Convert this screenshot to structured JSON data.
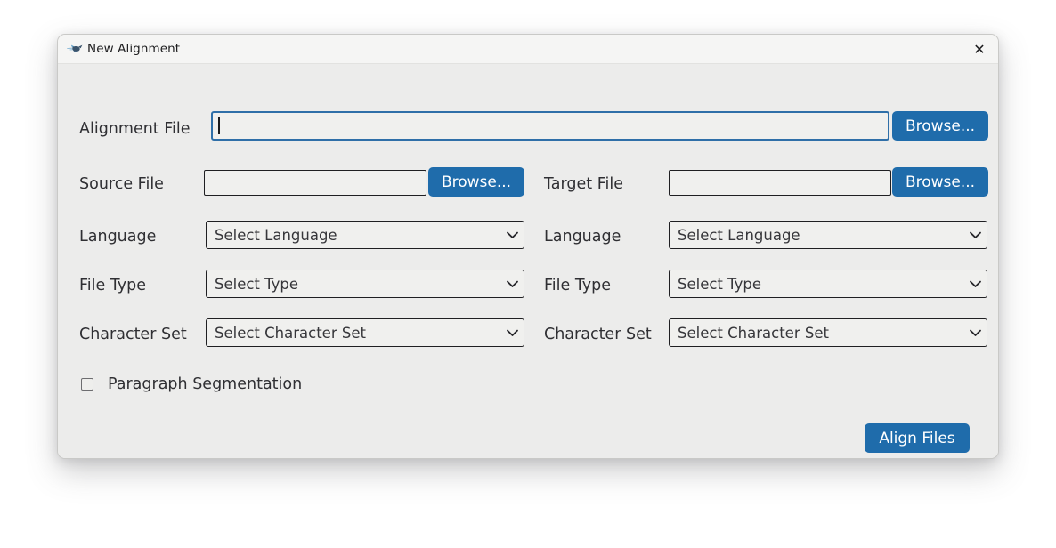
{
  "window": {
    "title": "New Alignment",
    "icon": "bird-logo-icon",
    "close_label": "✕"
  },
  "form": {
    "alignment_file": {
      "label": "Alignment File",
      "value": "",
      "placeholder": "",
      "browse_label": "Browse..."
    },
    "source": {
      "file_label": "Source File",
      "file_value": "",
      "browse_label": "Browse...",
      "language_label": "Language",
      "language_value": "Select Language",
      "filetype_label": "File Type",
      "filetype_value": "Select Type",
      "charset_label": "Character Set",
      "charset_value": "Select Character Set"
    },
    "target": {
      "file_label": "Target File",
      "file_value": "",
      "browse_label": "Browse...",
      "language_label": "Language",
      "language_value": "Select Language",
      "filetype_label": "File Type",
      "filetype_value": "Select Type",
      "charset_label": "Character Set",
      "charset_value": "Select Character Set"
    },
    "paragraph_segmentation": {
      "label": "Paragraph Segmentation",
      "checked": false
    },
    "submit": {
      "label": "Align Files"
    }
  },
  "colors": {
    "accent": "#1f6cab",
    "window_bg": "#ececeb",
    "titlebar_bg": "#f5f5f4",
    "field_bg": "#f0f0ee",
    "focus_border": "#2f6fa8",
    "text": "#2f2f33"
  }
}
